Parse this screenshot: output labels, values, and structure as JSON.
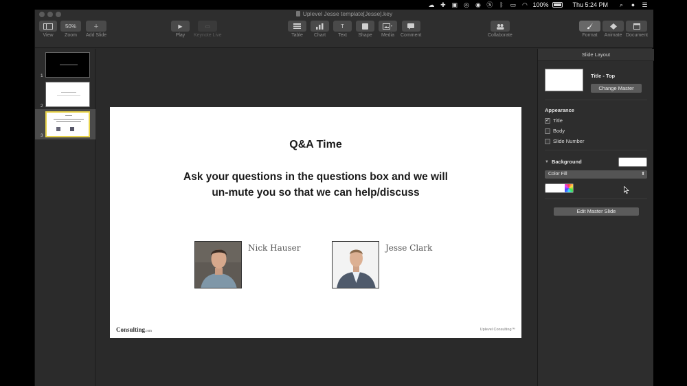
{
  "menubar": {
    "battery_pct": "100%",
    "clock": "Thu 5:24 PM"
  },
  "window": {
    "title": "Uplevel Jesse template[Jesse].key"
  },
  "toolbar": {
    "view_label": "View",
    "zoom_value": "50%",
    "zoom_label": "Zoom",
    "add_slide_label": "Add Slide",
    "play_label": "Play",
    "keynote_live_label": "Keynote Live",
    "table_label": "Table",
    "chart_label": "Chart",
    "text_label": "Text",
    "text_icon": "T",
    "shape_label": "Shape",
    "media_label": "Media",
    "comment_label": "Comment",
    "collaborate_label": "Collaborate",
    "format_label": "Format",
    "animate_label": "Animate",
    "document_label": "Document"
  },
  "navigator": {
    "slides": [
      {
        "number": "1",
        "style": "black"
      },
      {
        "number": "2",
        "style": "white"
      },
      {
        "number": "3",
        "style": "selected"
      }
    ]
  },
  "slide": {
    "title": "Q&A Time",
    "body_line1": "Ask your questions in the questions box and we will",
    "body_line2": "un-mute you so that we can help/discuss",
    "people": [
      {
        "name": "Nick Hauser"
      },
      {
        "name": "Jesse Clark"
      }
    ],
    "footer_left": "Consulting",
    "footer_left_small": ".com",
    "footer_right": "Uplevel Consulting™"
  },
  "inspector": {
    "header": "Slide Layout",
    "master_name": "Title - Top",
    "change_master_label": "Change Master",
    "appearance_title": "Appearance",
    "checkbox_title": "Title",
    "checkbox_title_checked": true,
    "checkbox_body": "Body",
    "checkbox_slide_number": "Slide Number",
    "background_title": "Background",
    "fill_type": "Color Fill",
    "fill_color": "#ffffff",
    "edit_master_label": "Edit Master Slide",
    "check_glyph": "✓",
    "select_arrow": "⬍",
    "disclosure_glyph": "▼"
  }
}
